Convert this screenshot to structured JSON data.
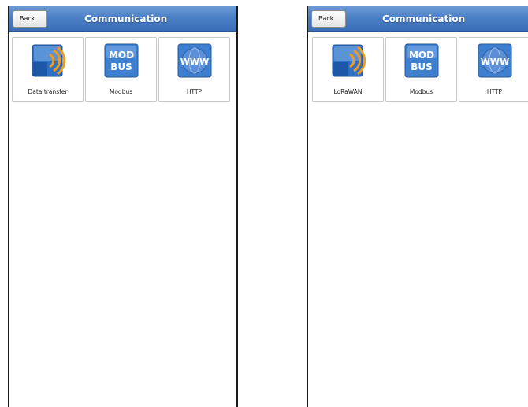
{
  "screens": [
    {
      "back_label": "Back",
      "title": "Communication",
      "tiles": [
        {
          "label": "Data transfer",
          "icon": "wireless-transfer-icon"
        },
        {
          "label": "Modbus",
          "icon": "modbus-icon",
          "icon_text": [
            "MOD",
            "BUS"
          ]
        },
        {
          "label": "HTTP",
          "icon": "www-globe-icon",
          "icon_text": "WWW"
        }
      ]
    },
    {
      "back_label": "Back",
      "title": "Communication",
      "tiles": [
        {
          "label": "LoRaWAN",
          "icon": "wireless-transfer-icon"
        },
        {
          "label": "Modbus",
          "icon": "modbus-icon",
          "icon_text": [
            "MOD",
            "BUS"
          ]
        },
        {
          "label": "HTTP",
          "icon": "www-globe-icon",
          "icon_text": "WWW"
        }
      ]
    }
  ],
  "colors": {
    "titlebar": "#4a7fc6",
    "icon_blue": "#3f7fd0",
    "icon_orange": "#f29a1e"
  }
}
